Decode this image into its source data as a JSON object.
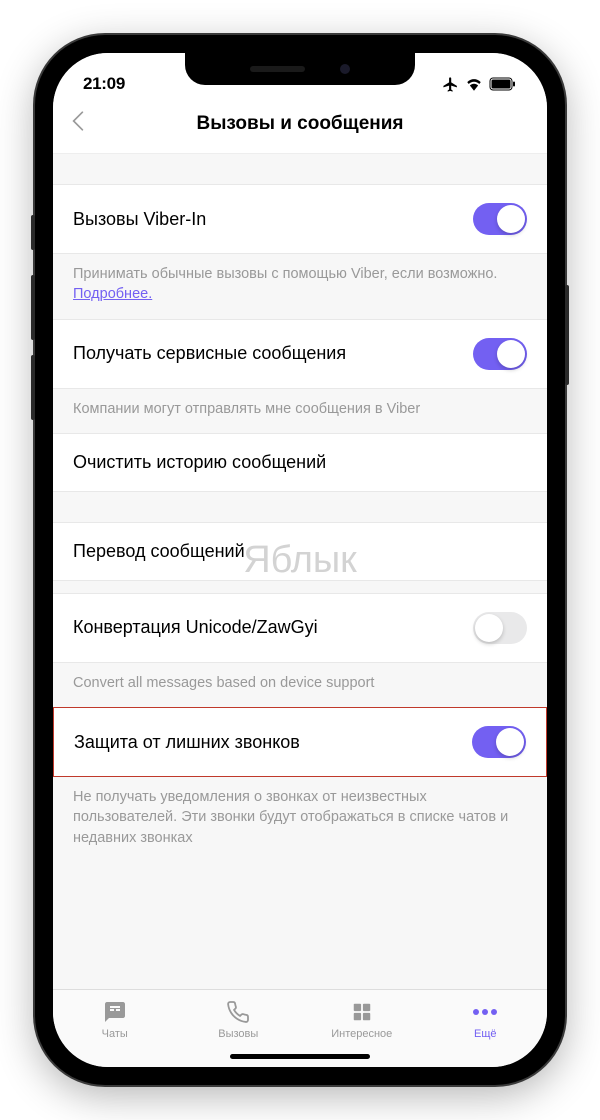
{
  "status": {
    "time": "21:09"
  },
  "header": {
    "title": "Вызовы и сообщения"
  },
  "watermark": "Яблык",
  "settings": {
    "viber_in": {
      "label": "Вызовы Viber-In",
      "desc_prefix": "Принимать обычные вызовы с помощью Viber, если возможно. ",
      "desc_link": "Подробнее.",
      "enabled": true
    },
    "service_messages": {
      "label": "Получать сервисные сообщения",
      "desc": "Компании могут отправлять мне сообщения в Viber",
      "enabled": true
    },
    "clear_history": {
      "label": "Очистить историю сообщений"
    },
    "translation": {
      "label": "Перевод сообщений"
    },
    "unicode": {
      "label": "Конвертация Unicode/ZawGyi",
      "desc": "Convert all messages based on device support",
      "enabled": false
    },
    "call_protection": {
      "label": "Защита от лишних звонков",
      "desc": "Не получать уведомления о звонках от неизвестных пользователей. Эти звонки будут отображаться в списке чатов и недавних звонках",
      "enabled": true
    }
  },
  "tabs": {
    "chats": "Чаты",
    "calls": "Вызовы",
    "explore": "Интересное",
    "more": "Ещё"
  }
}
